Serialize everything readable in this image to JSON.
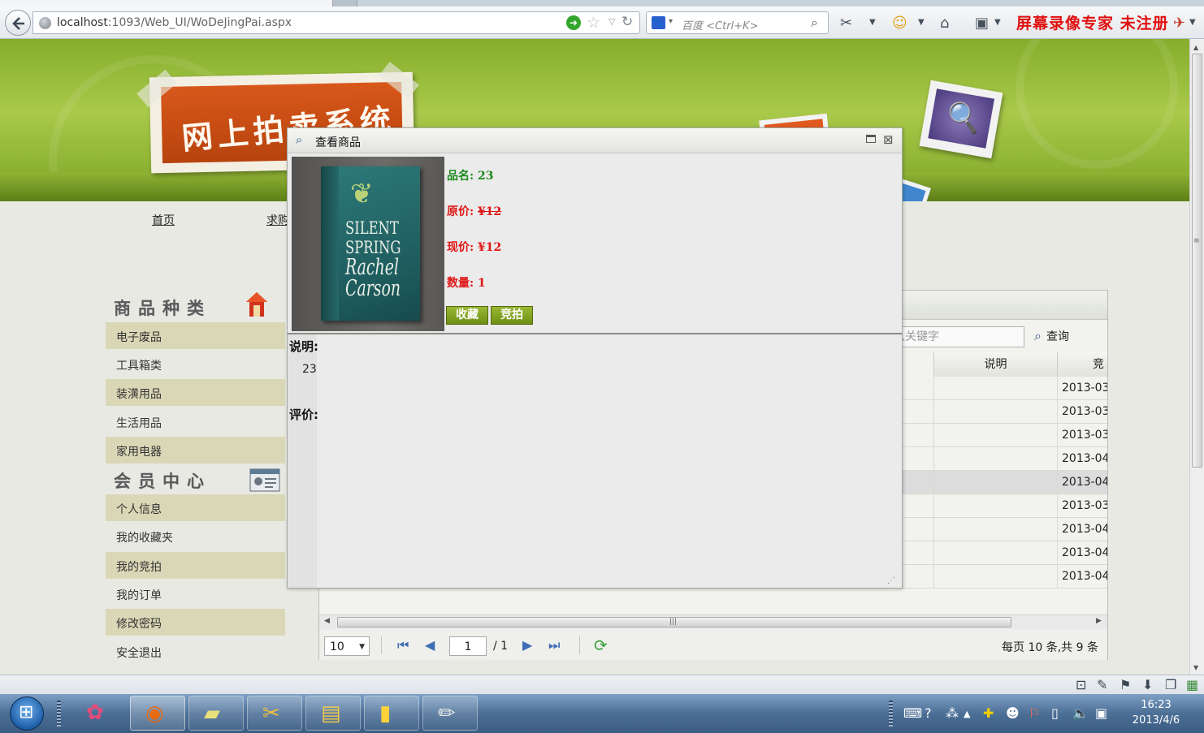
{
  "browser": {
    "url_host": "localhost",
    "url_path": ":1093/Web_UI/WoDeJingPai.aspx",
    "search_placeholder": "百度 <Ctrl+K>",
    "watermark": "屏幕录像专家  未注册"
  },
  "site": {
    "logo_text": "网上拍卖系统",
    "nav": [
      "首页",
      "求购"
    ]
  },
  "sidebar": {
    "category_title": "商品种类",
    "categories": [
      "电子废品",
      "工具箱类",
      "装潢用品",
      "生活用品",
      "家用电器"
    ],
    "member_title": "会员中心",
    "member_items": [
      "个人信息",
      "我的收藏夹",
      "我的竞拍",
      "我的订单",
      "修改密码",
      "安全退出"
    ]
  },
  "grid": {
    "keyword_placeholder": "入关键字",
    "query_label": "查询",
    "col_desc": "说明",
    "col_date": "竞",
    "dates": [
      "2013-03",
      "2013-03",
      "2013-03",
      "2013-04",
      "2013-04",
      "2013-03",
      "2013-04",
      "2013-04",
      "2013-04"
    ],
    "page_size": "10",
    "page_current": "1",
    "page_total": "/ 1",
    "page_info": "每页 10 条,共 9 条"
  },
  "modal": {
    "title": "查看商品",
    "name_label": "品名:",
    "name_value": "23",
    "orig_label": "原价:",
    "orig_value": "¥12",
    "now_label": "现价:",
    "now_value": "¥12",
    "qty_label": "数量:",
    "qty_value": "1",
    "btn_fav": "收藏",
    "btn_bid": "竞拍",
    "desc_label": "说明:",
    "desc_value": "23",
    "review_label": "评价:",
    "book_title": "SILENT SPRING",
    "book_author": "Rachel Carson"
  },
  "taskbar": {
    "time": "16:23",
    "date": "2013/4/6"
  }
}
